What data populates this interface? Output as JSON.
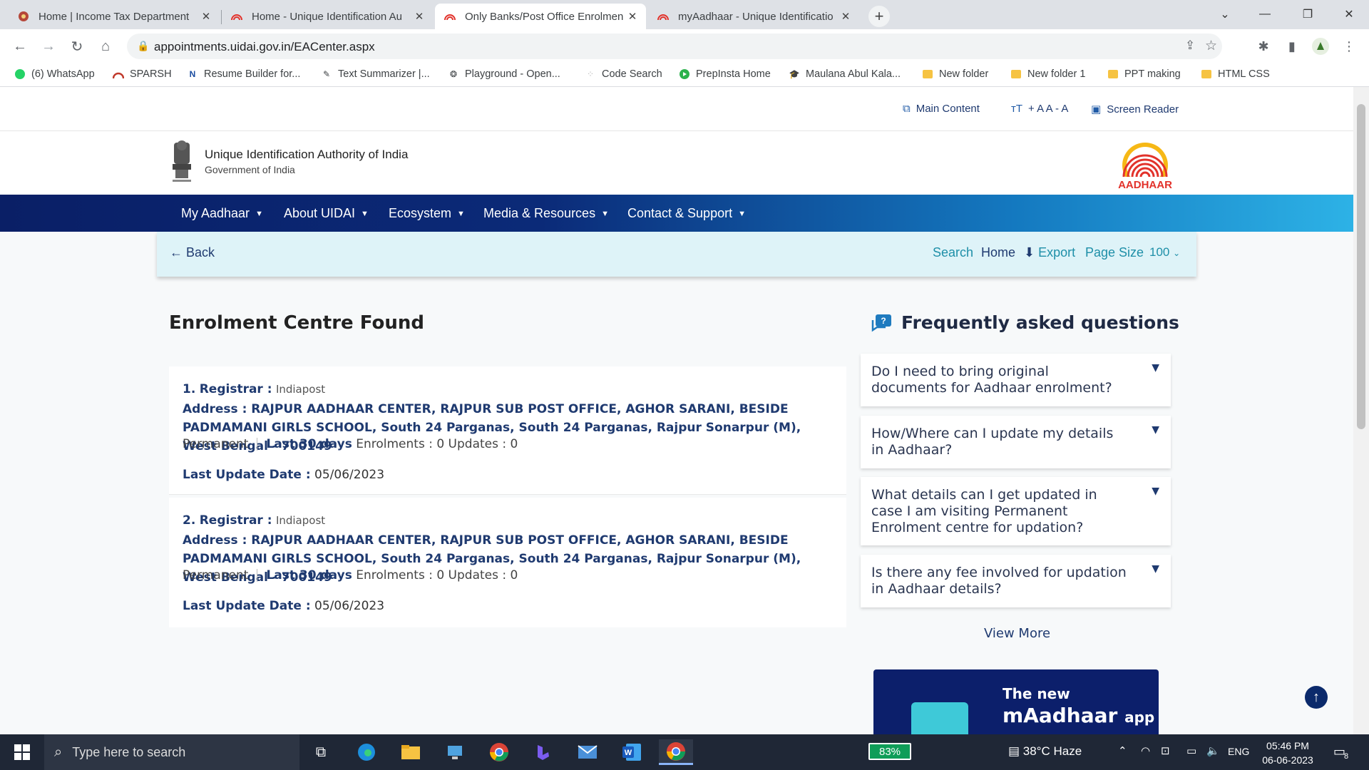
{
  "browser": {
    "tabs": [
      {
        "title": "Home | Income Tax Department",
        "active": false
      },
      {
        "title": "Home - Unique Identification Au",
        "active": false
      },
      {
        "title": "Only Banks/Post Office Enrolmen",
        "active": true
      },
      {
        "title": "myAadhaar - Unique Identificatio",
        "active": false
      }
    ],
    "url": "appointments.uidai.gov.in/EACenter.aspx",
    "bookmarks": [
      "(6) WhatsApp",
      "SPARSH",
      "Resume Builder for...",
      "Text Summarizer |...",
      "Playground - Open...",
      "Code Search",
      "PrepInsta Home",
      "Maulana Abul Kala...",
      "New folder",
      "New folder 1",
      "PPT making",
      "HTML CSS"
    ]
  },
  "utility": {
    "main_content": "Main Content",
    "text_size": "+ A A - A",
    "screen_reader": "Screen Reader"
  },
  "header": {
    "org_name": "Unique Identification Authority of India",
    "org_sub": "Government of India",
    "logo_text": "AADHAAR"
  },
  "nav": [
    "My Aadhaar",
    "About UIDAI",
    "Ecosystem",
    "Media & Resources",
    "Contact & Support"
  ],
  "actionbar": {
    "back": "Back",
    "search": "Search",
    "home": "Home",
    "export": "Export",
    "page_size_label": "Page Size",
    "page_size_value": "100"
  },
  "main": {
    "title": "Enrolment Centre Found",
    "centres": [
      {
        "num": "1.",
        "registrar_label": "Registrar :",
        "registrar": "Indiapost",
        "address_label": "Address :",
        "address": "RAJPUR AADHAAR CENTER, RAJPUR SUB POST OFFICE, AGHOR SARANI, BESIDE PADMAMANI GIRLS SCHOOL, South 24 Parganas, South 24 Parganas, Rajpur Sonarpur (M), West Bengal - 700149",
        "type": "Permanent",
        "last30": "Last 30 days",
        "stats": "Enrolments : 0 Updates : 0",
        "lud_label": "Last Update Date :",
        "lud": "05/06/2023"
      },
      {
        "num": "2.",
        "registrar_label": "Registrar :",
        "registrar": "Indiapost",
        "address_label": "Address :",
        "address": "RAJPUR AADHAAR CENTER, RAJPUR SUB POST OFFICE, AGHOR SARANI, BESIDE PADMAMANI GIRLS SCHOOL, South 24 Parganas, South 24 Parganas, Rajpur Sonarpur (M), West Bengal - 700149",
        "type": "Permanent",
        "last30": "Last 30 days",
        "stats": "Enrolments : 0 Updates : 0",
        "lud_label": "Last Update Date :",
        "lud": "05/06/2023"
      }
    ]
  },
  "faq": {
    "title": "Frequently asked questions",
    "items": [
      "Do I need to bring original documents for Aadhaar enrolment?",
      "How/Where can I update my details in Aadhaar?",
      "What details can I get updated in case I am visiting Permanent Enrolment centre for updation?",
      "Is there any fee involved for updation in Aadhaar details?"
    ],
    "view_more": "View More"
  },
  "promo": {
    "line1": "The new",
    "line2": "mAadhaar",
    "line3": "app"
  },
  "taskbar": {
    "search_placeholder": "Type here to search",
    "battery": "83%",
    "weather": "38°C  Haze",
    "lang": "ENG",
    "time": "05:46 PM",
    "date": "06-06-2023",
    "notif_count": "8"
  },
  "colors": {
    "nav_start": "#0a1f66",
    "nav_end": "#2db2e6",
    "accent": "#1f3a70",
    "action_bg": "#def3f8"
  }
}
